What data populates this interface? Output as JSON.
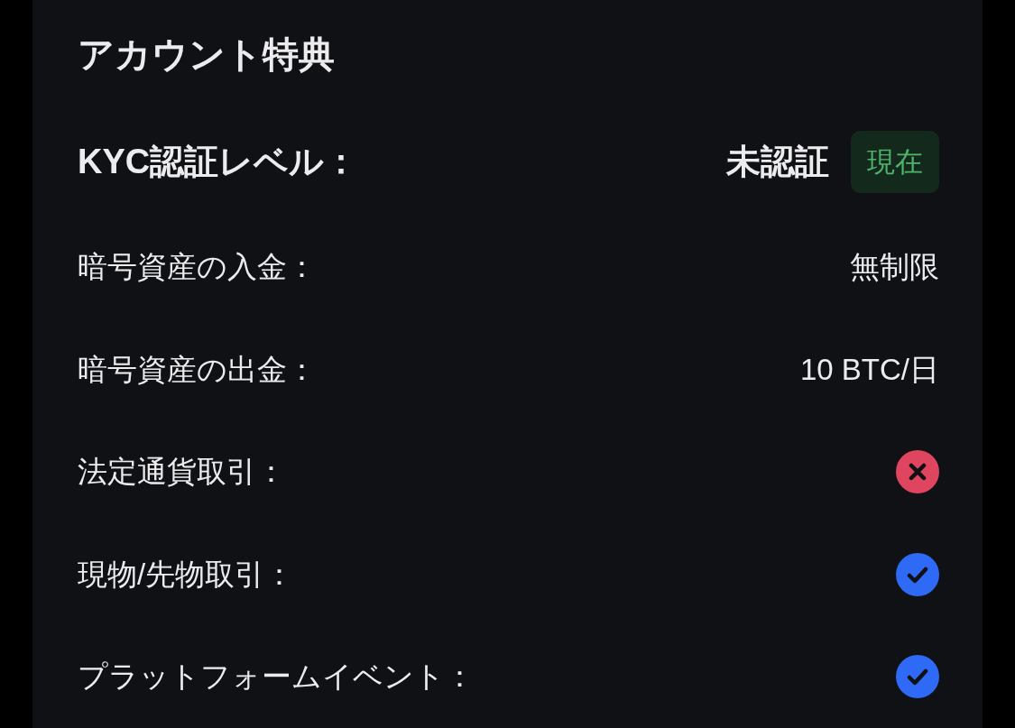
{
  "title": "アカウント特典",
  "kyc": {
    "label": "KYC認証レベル：",
    "value": "未認証",
    "badge": "現在"
  },
  "benefits": [
    {
      "label": "暗号資産の入金：",
      "kind": "text",
      "value": "無制限"
    },
    {
      "label": "暗号資産の出金：",
      "kind": "text",
      "value": "10 BTC/日"
    },
    {
      "label": "法定通貨取引：",
      "kind": "status",
      "available": false
    },
    {
      "label": "現物/先物取引：",
      "kind": "status",
      "available": true
    },
    {
      "label": "プラットフォームイベント：",
      "kind": "status",
      "available": true
    }
  ]
}
